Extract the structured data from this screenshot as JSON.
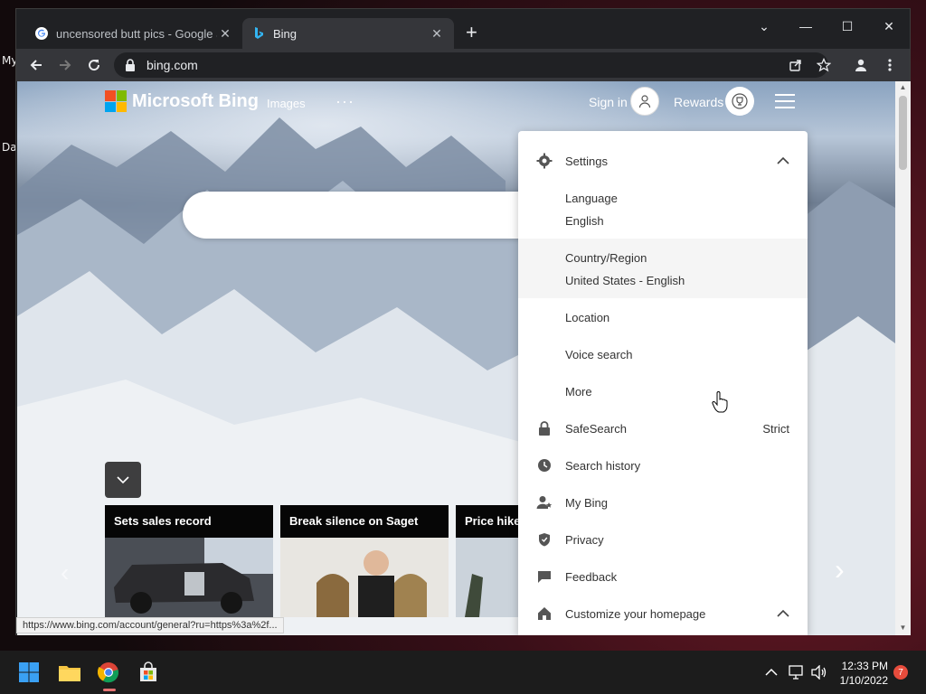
{
  "desktop": {
    "labels": [
      "My",
      "Da"
    ]
  },
  "browser": {
    "tabs": [
      {
        "title": "uncensored butt pics - Google Se",
        "favicon": "google-icon",
        "close": "✕"
      },
      {
        "title": "Bing",
        "favicon": "bing-icon",
        "close": "✕"
      }
    ],
    "new_tab": "+",
    "url": "bing.com",
    "window_controls": {
      "tab_search": "⌄",
      "minimize": "—",
      "maximize": "☐",
      "close": "✕"
    }
  },
  "bing": {
    "logo_text": "Microsoft Bing",
    "nav_images": "Images",
    "nav_more": "···",
    "sign_in": "Sign in",
    "rewards": "Rewards",
    "cards": [
      {
        "title": "Sets sales record"
      },
      {
        "title": "Break silence on Saget"
      },
      {
        "title": "Price hike"
      }
    ]
  },
  "settings_panel": {
    "header": "Settings",
    "language_label": "Language",
    "language_value": "English",
    "country_label": "Country/Region",
    "country_value": "United States - English",
    "location": "Location",
    "voice_search": "Voice search",
    "more": "More",
    "safesearch_label": "SafeSearch",
    "safesearch_value": "Strict",
    "search_history": "Search history",
    "my_bing": "My Bing",
    "privacy": "Privacy",
    "feedback": "Feedback",
    "customize": "Customize your homepage"
  },
  "status_url": "https://www.bing.com/account/general?ru=https%3a%2f...",
  "taskbar": {
    "time": "12:33 PM",
    "date": "1/10/2022",
    "notification_count": "7"
  },
  "colors": {
    "ms_red": "#f25022",
    "ms_green": "#7fba00",
    "ms_blue": "#00a4ef",
    "ms_yellow": "#ffb900",
    "chrome_dark": "#202124",
    "chrome_tab": "#35363a"
  }
}
